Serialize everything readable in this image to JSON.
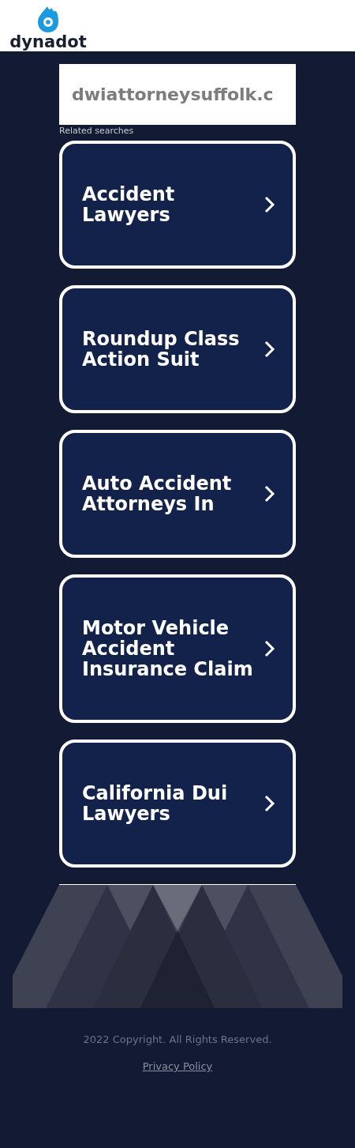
{
  "header": {
    "logo": "dynadot"
  },
  "domain": "dwiattorneysuffolk.c",
  "related_label": "Related searches",
  "searches": [
    {
      "label": "Accident Lawyers"
    },
    {
      "label": "Roundup Class Action Suit"
    },
    {
      "label": "Auto Accident Attorneys In"
    },
    {
      "label": "Motor Vehicle Accident Insurance Claim"
    },
    {
      "label": "California Dui Lawyers"
    }
  ],
  "footer": {
    "copyright": "2022 Copyright. All Rights Reserved.",
    "privacy": "Privacy Policy"
  }
}
